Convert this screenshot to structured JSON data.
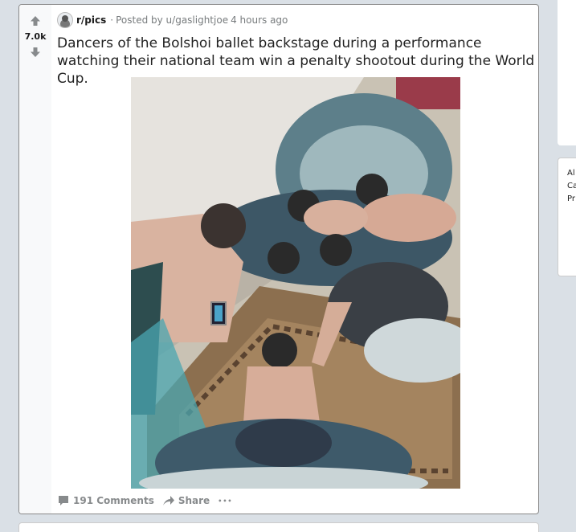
{
  "post": {
    "score": "7.0k",
    "subreddit": "r/pics",
    "posted_by": "Posted by u/gaslightjoe",
    "time_ago": "4 hours ago",
    "title": "Dancers of the Bolshoi ballet backstage during a performance watching their national team win a penalty shootout during the World Cup.",
    "actions": {
      "comments": "191 Comments",
      "share": "Share",
      "more": "•••"
    }
  },
  "sidebar": {
    "lines": [
      "Al",
      "Ca",
      "Pr"
    ]
  },
  "colors": {
    "background": "#dae0e6",
    "card": "#ffffff",
    "vote_column": "#f8f9fa",
    "icon_gray": "#878a8c"
  }
}
